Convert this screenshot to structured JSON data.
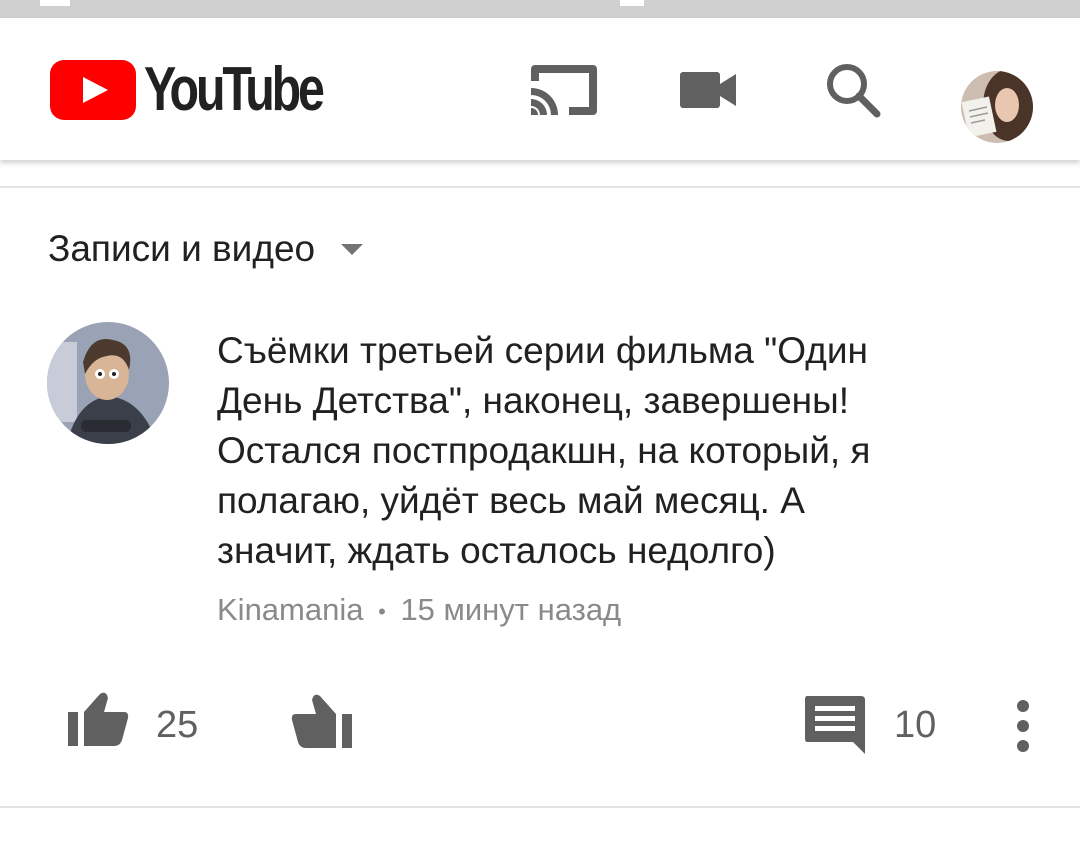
{
  "header": {
    "logo_text": "YouTube",
    "icons": [
      "cast-icon",
      "video-camera-icon",
      "search-icon",
      "account-avatar"
    ]
  },
  "filter": {
    "label": "Записи и видео"
  },
  "post": {
    "text": "Съёмки третьей серии фильма \"Один\nДень Детства\", наконец, завершены!\nОстался постпродакшн, на который, я\nполагаю, уйдёт весь май месяц. А\nзначит, ждать осталось недолго)",
    "author": "Kinamania",
    "separator": "•",
    "time": "15 минут назад"
  },
  "actions": {
    "likes": "25",
    "comments": "10"
  },
  "colors": {
    "brand_red": "#ff0000",
    "icon_gray": "#606060",
    "meta_gray": "#8a8a8a"
  }
}
